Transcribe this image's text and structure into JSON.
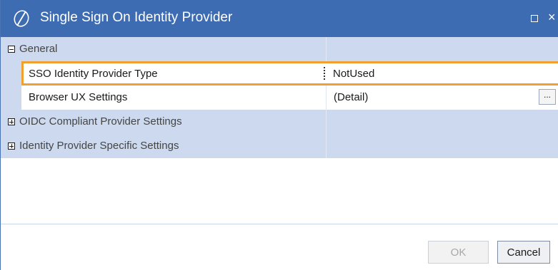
{
  "window": {
    "title": "Single Sign On Identity Provider",
    "title_bar_color": "#3d6cb2"
  },
  "grid": {
    "categories": {
      "general": {
        "label": "General",
        "expanded": true
      },
      "oidc": {
        "label": "OIDC Compliant Provider Settings",
        "expanded": false
      },
      "idp_specific": {
        "label": "Identity Provider Specific Settings",
        "expanded": false
      }
    },
    "properties": [
      {
        "name": "SSO Identity Provider Type",
        "value": "NotUsed",
        "selected": true
      },
      {
        "name": "Browser UX Settings",
        "value": "(Detail)",
        "selected": false,
        "ellipsis": "..."
      }
    ],
    "category_color": "#ccd9ef",
    "selection_color": "#f0a030"
  },
  "footer": {
    "ok_label": "OK",
    "cancel_label": "Cancel"
  }
}
